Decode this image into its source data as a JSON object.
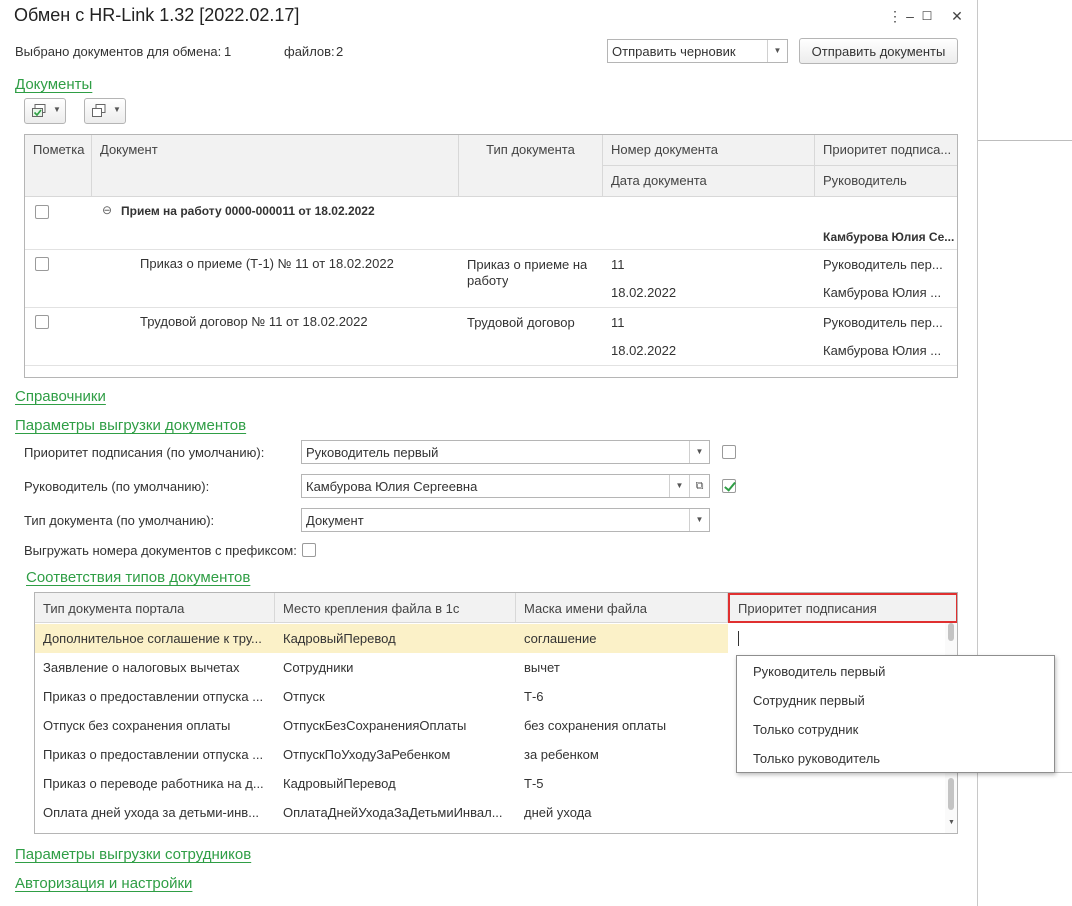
{
  "window": {
    "title": "Обмен с HR-Link 1.32 [2022.02.17]",
    "menu_glyph": "⋮",
    "min_glyph": "–",
    "max_glyph": "☐",
    "close_glyph": "✕"
  },
  "summary": {
    "selected_label": "Выбрано документов для обмена:",
    "selected_count": "1",
    "files_label": "файлов:",
    "files_count": "2"
  },
  "send": {
    "mode_value": "Отправить черновик",
    "send_button": "Отправить документы"
  },
  "sections": {
    "documents": "Документы",
    "directories": "Справочники",
    "doc_export_params": "Параметры выгрузки документов",
    "type_mapping": "Соответствия типов документов",
    "employee_export_params": "Параметры выгрузки сотрудников",
    "auth_settings": "Авторизация и настройки"
  },
  "documents_grid": {
    "headers": {
      "mark": "Пометка",
      "document": "Документ",
      "doc_type": "Тип документа",
      "doc_number": "Номер документа",
      "doc_date": "Дата документа",
      "sign_priority": "Приоритет подписа...",
      "manager": "Руководитель"
    },
    "group": {
      "toggle": "⊖",
      "title": "Прием на работу 0000-000011 от 18.02.2022",
      "manager": "Камбурова Юлия Се..."
    },
    "rows": [
      {
        "document": "Приказ о приеме (Т-1) № 11 от 18.02.2022",
        "doc_type_line1": "Приказ о приеме на",
        "doc_type_line2": "работу",
        "number": "11",
        "date": "18.02.2022",
        "priority": "Руководитель пер...",
        "manager": "Камбурова Юлия ..."
      },
      {
        "document": "Трудовой договор № 11 от 18.02.2022",
        "doc_type_line1": "Трудовой договор",
        "doc_type_line2": "",
        "number": "11",
        "date": "18.02.2022",
        "priority": "Руководитель пер...",
        "manager": "Камбурова Юлия ..."
      }
    ]
  },
  "params": {
    "priority_label": "Приоритет подписания (по умолчанию):",
    "priority_value": "Руководитель первый",
    "manager_label": "Руководитель (по умолчанию):",
    "manager_value": "Камбурова Юлия Сергеевна",
    "doc_type_label": "Тип документа (по умолчанию):",
    "doc_type_value": "Документ",
    "prefix_label": "Выгружать номера документов с префиксом:"
  },
  "mapping_grid": {
    "headers": {
      "portal_type": "Тип документа портала",
      "attach_place": "Место крепления файла в 1с",
      "file_mask": "Маска имени файла",
      "sign_priority": "Приоритет подписания"
    },
    "rows": [
      {
        "portal_type": "Дополнительное соглашение к тру...",
        "attach_place": "КадровыйПеревод",
        "file_mask": "соглашение",
        "priority": ""
      },
      {
        "portal_type": "Заявление о налоговых вычетах",
        "attach_place": "Сотрудники",
        "file_mask": "вычет",
        "priority": ""
      },
      {
        "portal_type": "Приказ о предоставлении отпуска ...",
        "attach_place": "Отпуск",
        "file_mask": "Т-6",
        "priority": ""
      },
      {
        "portal_type": "Отпуск без сохранения оплаты",
        "attach_place": "ОтпускБезСохраненияОплаты",
        "file_mask": "без сохранения оплаты",
        "priority": ""
      },
      {
        "portal_type": "Приказ о предоставлении отпуска ...",
        "attach_place": "ОтпускПоУходуЗаРебенком",
        "file_mask": "за ребенком",
        "priority": ""
      },
      {
        "portal_type": "Приказ о переводе работника на д...",
        "attach_place": "КадровыйПеревод",
        "file_mask": "Т-5",
        "priority": ""
      },
      {
        "portal_type": "Оплата дней ухода за детьми-инв...",
        "attach_place": "ОплатаДнейУходаЗаДетьмиИнвал...",
        "file_mask": "дней ухода",
        "priority": ""
      }
    ]
  },
  "priority_dropdown": {
    "options": [
      "Руководитель первый",
      "Сотрудник первый",
      "Только сотрудник",
      "Только руководитель"
    ]
  },
  "colors": {
    "link_green": "#2f9e45",
    "selected_row": "#fbf1c8",
    "focus_red": "#e03030"
  }
}
